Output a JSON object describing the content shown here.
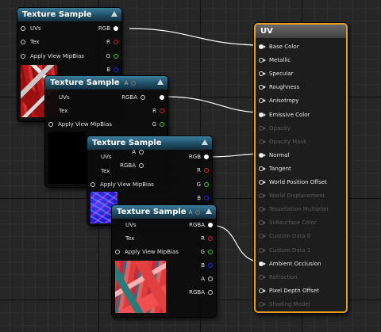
{
  "nodes": {
    "ts1": {
      "title": "Texture Sample",
      "inputs": [
        "UVs",
        "Tex",
        "Apply View MipBias"
      ],
      "outputs": [
        "RGB",
        "R",
        "G",
        "B"
      ]
    },
    "ts2": {
      "title": "Texture Sample",
      "a_label": "A",
      "inputs": [
        "UVs",
        "Tex",
        "Apply View MipBias"
      ],
      "outputs": [
        "RGBA",
        "R",
        "G"
      ]
    },
    "ts3": {
      "title": "Texture Sample",
      "a_label": "A",
      "inputs": [
        "UVs",
        "Tex",
        "Apply View MipBias"
      ],
      "outputs": [
        "RGB",
        "RGBA",
        "R",
        "G",
        "B"
      ]
    },
    "ts4": {
      "title": "Texture Sample",
      "a_label": "A",
      "inputs": [
        "UVs",
        "Tex",
        "Apply View MipBias"
      ],
      "outputs": [
        "RGBA",
        "R",
        "G",
        "B",
        "A",
        "RGBA"
      ]
    }
  },
  "result_node": {
    "title": "UV",
    "inputs": [
      {
        "label": "Base Color",
        "enabled": true,
        "connected": true
      },
      {
        "label": "Metallic",
        "enabled": true,
        "connected": false
      },
      {
        "label": "Specular",
        "enabled": true,
        "connected": false
      },
      {
        "label": "Roughness",
        "enabled": true,
        "connected": false
      },
      {
        "label": "Anisotropy",
        "enabled": true,
        "connected": false
      },
      {
        "label": "Emissive Color",
        "enabled": true,
        "connected": true
      },
      {
        "label": "Opacity",
        "enabled": false,
        "connected": false
      },
      {
        "label": "Opacity Mask",
        "enabled": false,
        "connected": false
      },
      {
        "label": "Normal",
        "enabled": true,
        "connected": true
      },
      {
        "label": "Tangent",
        "enabled": true,
        "connected": false
      },
      {
        "label": "World Position Offset",
        "enabled": true,
        "connected": false
      },
      {
        "label": "World Displacement",
        "enabled": false,
        "connected": false
      },
      {
        "label": "Tessellation Multiplier",
        "enabled": false,
        "connected": false
      },
      {
        "label": "Subsurface Color",
        "enabled": false,
        "connected": false
      },
      {
        "label": "Custom Data 0",
        "enabled": false,
        "connected": false
      },
      {
        "label": "Custom Data 1",
        "enabled": false,
        "connected": false
      },
      {
        "label": "Ambient Occlusion",
        "enabled": true,
        "connected": true
      },
      {
        "label": "Refraction",
        "enabled": false,
        "connected": false
      },
      {
        "label": "Pixel Depth Offset",
        "enabled": true,
        "connected": false
      },
      {
        "label": "Shading Model",
        "enabled": false,
        "connected": false
      }
    ]
  },
  "colors": {
    "accent": "#e3a028",
    "header": "#2a6580",
    "wire": "#ffffff"
  }
}
